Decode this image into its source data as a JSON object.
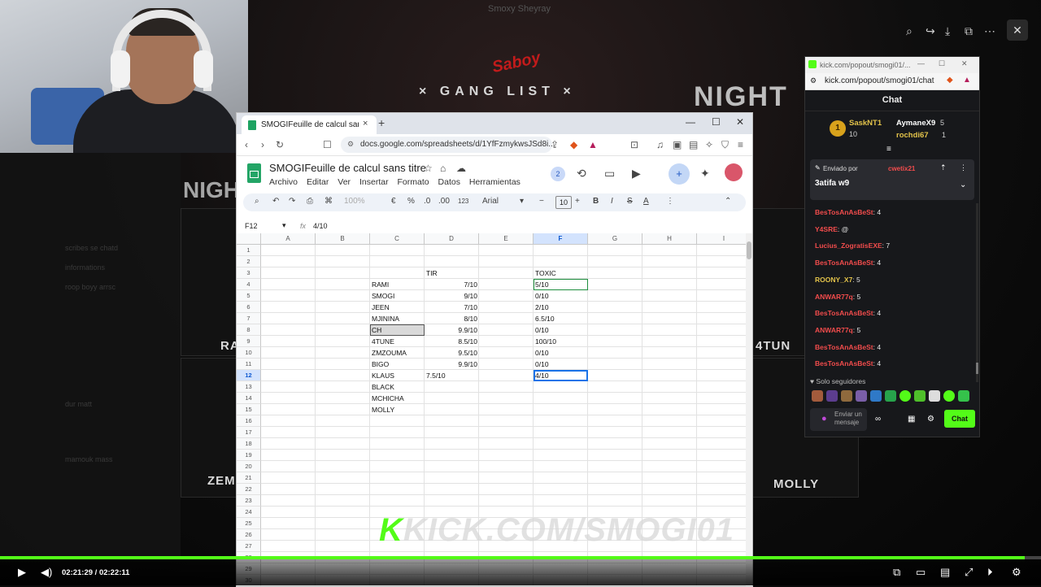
{
  "stream": {
    "title": "Smoxy Sheyray",
    "gang_title": "× GANG LIST ×",
    "brand": "Saboy",
    "night": "NIGHT",
    "posters": [
      "RAI",
      "4TUN",
      "ZEMZ",
      "MOLLY"
    ],
    "watermark_k": "K",
    "watermark_text": "KICK.COM/SMOGI01",
    "left_panel_rows": [
      "scribes se chatd",
      "informations",
      "roop boyy arrsc",
      "dur matt",
      "mamouk mass"
    ]
  },
  "browser": {
    "tab_title": "SMOGIFeuille de calcul sans titre",
    "tab_close": "×",
    "new_tab": "+",
    "minimize": "—",
    "maximize": "☐",
    "close": "✕",
    "url": "docs.google.com/spreadsheets/d/1YfFzmykwsJSd8i..."
  },
  "sheets": {
    "doc_title": "SMOGIFeuille de calcul sans titre",
    "menu": [
      "Archivo",
      "Editar",
      "Ver",
      "Insertar",
      "Formato",
      "Datos",
      "Herramientas"
    ],
    "collab_count": "2",
    "toolbar": {
      "zoom": "100%",
      "currency": "€",
      "percent": "%",
      "dec_less": ".0",
      "dec_more": ".00",
      "number_format": "123",
      "font": "Arial",
      "font_size": "10",
      "bold": "B",
      "italic": "I",
      "strike": "S",
      "text_color": "A"
    },
    "name_box": "F12",
    "fx": "fx",
    "formula_value": "4/10",
    "columns": [
      "A",
      "B",
      "C",
      "D",
      "E",
      "F",
      "G",
      "H",
      "I"
    ],
    "rows": [
      "1",
      "2",
      "3",
      "4",
      "5",
      "6",
      "7",
      "8",
      "9",
      "10",
      "11",
      "12",
      "13",
      "14",
      "15",
      "16",
      "17",
      "18",
      "19",
      "20",
      "21",
      "22",
      "23",
      "24",
      "25",
      "26",
      "27",
      "28",
      "29",
      "30"
    ],
    "headers": {
      "tir": "TIR",
      "toxic": "TOXIC"
    },
    "players": [
      {
        "name": "RAMI",
        "tir": "7/10",
        "toxic": "5/10"
      },
      {
        "name": "SMOGI",
        "tir": "9/10",
        "toxic": "0/10"
      },
      {
        "name": "JEEN",
        "tir": "7/10",
        "toxic": "2/10"
      },
      {
        "name": "MJININA",
        "tir": "8/10",
        "toxic": "6.5/10"
      },
      {
        "name": "CH",
        "tir": "9.9/10",
        "toxic": "0/10"
      },
      {
        "name": "4TUNE",
        "tir": "8.5/10",
        "toxic": "100/10"
      },
      {
        "name": "ZMZOUMA",
        "tir": "9.5/10",
        "toxic": "0/10"
      },
      {
        "name": "BIGO",
        "tir": "9.9/10",
        "toxic": "0/10"
      },
      {
        "name": "KLAUS",
        "tir": "7.5/10",
        "toxic": "4/10"
      },
      {
        "name": "BLACK",
        "tir": "",
        "toxic": ""
      },
      {
        "name": "MCHICHA",
        "tir": "",
        "toxic": ""
      },
      {
        "name": "MOLLY",
        "tir": "",
        "toxic": ""
      }
    ]
  },
  "chat": {
    "window_url_short": "kick.com/popout/smogi01/...",
    "url": "kick.com/popout/smogi01/chat",
    "header": "Chat",
    "top": [
      {
        "rank": "1",
        "name": "SaskNT1",
        "count": "10"
      },
      {
        "name": "AymaneX9",
        "count": "5"
      },
      {
        "name": "rochdi67",
        "count": "1"
      }
    ],
    "pinned_by_label": "Enviado por",
    "pinned_by_user": "cwetix21",
    "pinned_text": "3atifa w9",
    "messages": [
      {
        "user": "BesTosAnAsBeSt",
        "text": ": 4"
      },
      {
        "user": "Y4SRE",
        "text": ": @"
      },
      {
        "user": "Lucius_ZogratisEXE",
        "text": ": 7"
      },
      {
        "user": "BesTosAnAsBeSt",
        "text": ": 4"
      },
      {
        "user": "ROONY_X7",
        "text": ": 5"
      },
      {
        "user": "ANWAR77q",
        "text": ": 5"
      },
      {
        "user": "BesTosAnAsBeSt",
        "text": ": 4"
      },
      {
        "user": "ANWAR77q",
        "text": ": 5"
      },
      {
        "user": "BesTosAnAsBeSt",
        "text": ": 4"
      },
      {
        "user": "BesTosAnAsBeSt",
        "text": ": 4"
      }
    ],
    "followers_only": "Solo seguidores",
    "input_placeholder": "Enviar un mensaje",
    "send_label": "Chat"
  },
  "player": {
    "current_time": "02:21:29",
    "separator": " / ",
    "duration": "02:22:11",
    "progress": 0.984
  },
  "colors": {
    "kick_green": "#53fc18",
    "sheets_green": "#23a566",
    "selection_blue": "#1a73e8",
    "chat_user_red": "#f24c4c"
  }
}
